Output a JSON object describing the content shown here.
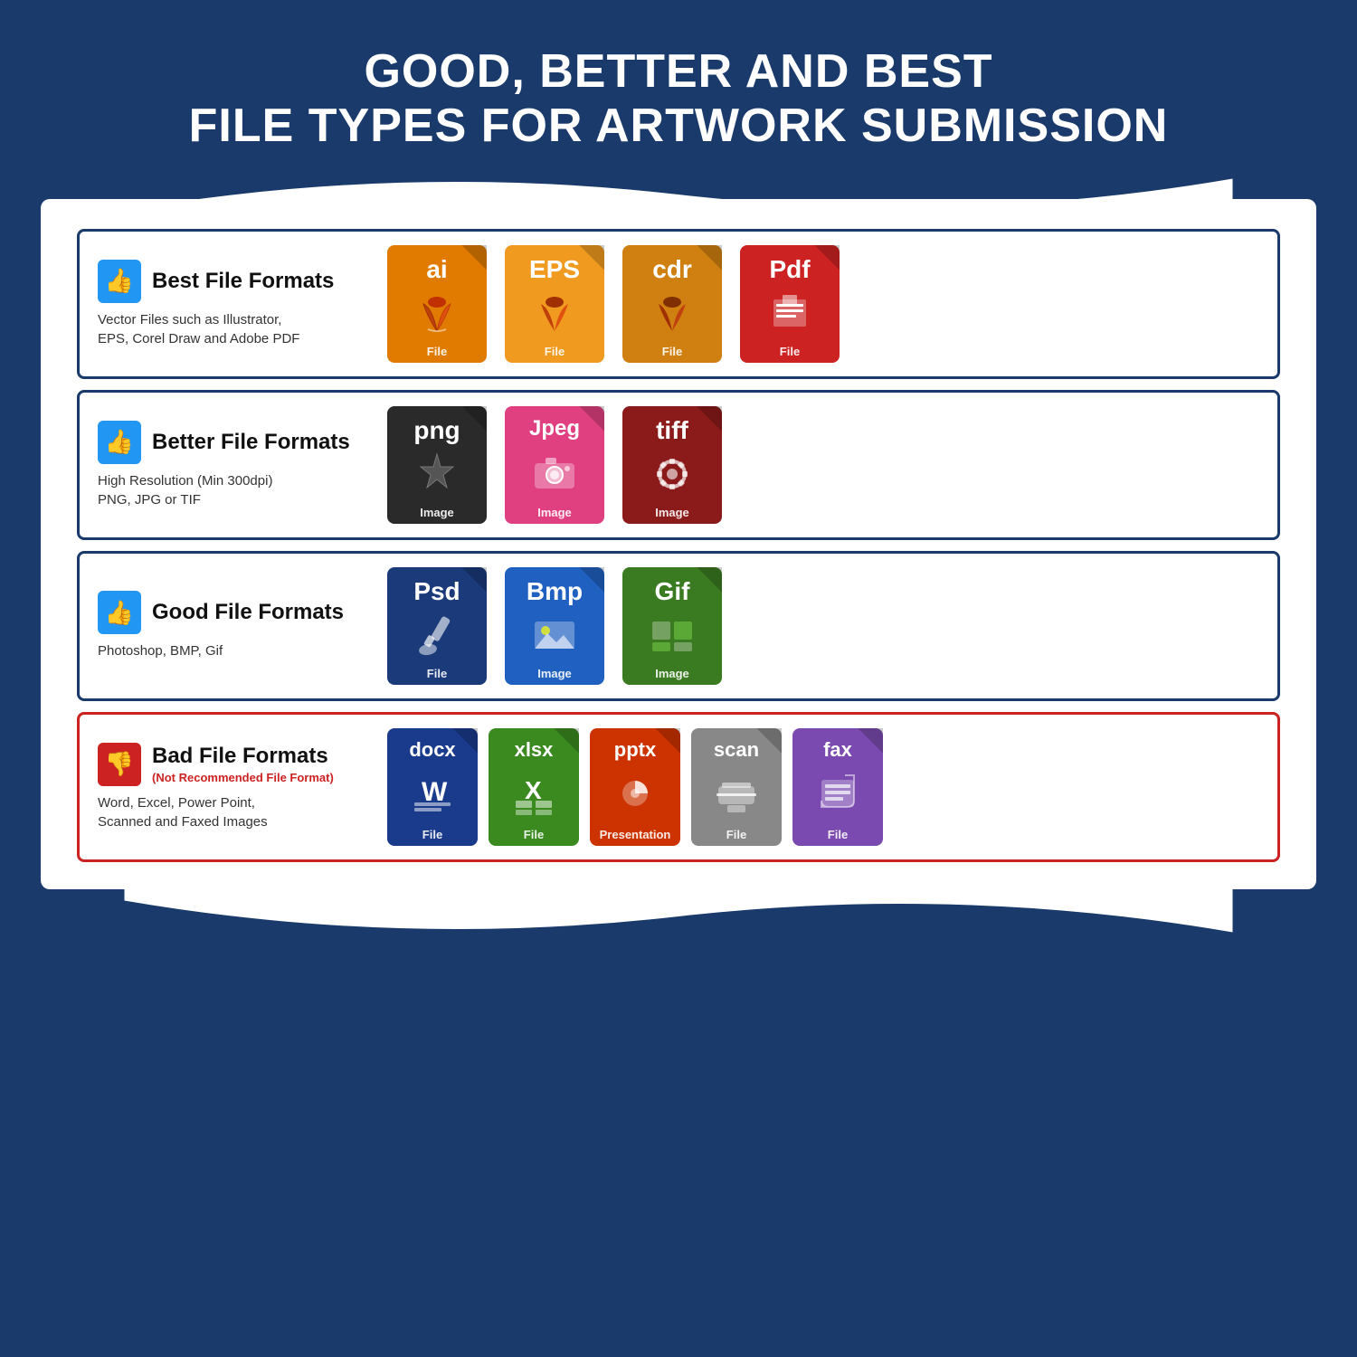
{
  "header": {
    "line1": "GOOD, BETTER AND BEST",
    "line2": "FILE TYPES FOR ARTWORK SUBMISSION"
  },
  "rows": [
    {
      "id": "best",
      "thumb": "👍",
      "thumbBad": false,
      "title": "Best File Formats",
      "subtitle": "",
      "desc": "Vector Files such as Illustrator,\nEPS, Corel Draw and Adobe PDF",
      "borderColor": "#1a3a6b",
      "files": [
        {
          "label": "ai",
          "sublabel": "File",
          "color": "#e07b00",
          "iconType": "pen"
        },
        {
          "label": "EPS",
          "sublabel": "File",
          "color": "#f09a20",
          "iconType": "pen"
        },
        {
          "label": "cdr",
          "sublabel": "File",
          "color": "#d08010",
          "iconType": "pen"
        },
        {
          "label": "Pdf",
          "sublabel": "File",
          "color": "#cc2222",
          "iconType": "doc"
        }
      ]
    },
    {
      "id": "better",
      "thumb": "👍",
      "thumbBad": false,
      "title": "Better File Formats",
      "subtitle": "",
      "desc": "High Resolution (Min 300dpi)\nPNG, JPG or TIF",
      "borderColor": "#1a3a6b",
      "files": [
        {
          "label": "png",
          "sublabel": "Image",
          "color": "#2a2a2a",
          "iconType": "star"
        },
        {
          "label": "Jpeg",
          "sublabel": "Image",
          "color": "#e04080",
          "iconType": "camera"
        },
        {
          "label": "tiff",
          "sublabel": "Image",
          "color": "#8b1a1a",
          "iconType": "gear"
        }
      ]
    },
    {
      "id": "good",
      "thumb": "👍",
      "thumbBad": false,
      "title": "Good File Formats",
      "subtitle": "",
      "desc": "Photoshop, BMP, Gif",
      "borderColor": "#1a3a6b",
      "files": [
        {
          "label": "Psd",
          "sublabel": "File",
          "color": "#1a3a7a",
          "iconType": "brush"
        },
        {
          "label": "Bmp",
          "sublabel": "Image",
          "color": "#2060c0",
          "iconType": "landscape"
        },
        {
          "label": "Gif",
          "sublabel": "Image",
          "color": "#3a7a20",
          "iconType": "grid"
        }
      ]
    },
    {
      "id": "bad",
      "thumb": "👎",
      "thumbBad": true,
      "title": "Bad File Formats",
      "subtitle": "(Not Recommended File Format)",
      "desc": "Word, Excel, Power Point,\nScanned and Faxed Images",
      "borderColor": "#cc2222",
      "files": [
        {
          "label": "docx",
          "sublabel": "File",
          "color": "#1a3a8b",
          "iconType": "word"
        },
        {
          "label": "xlsx",
          "sublabel": "File",
          "color": "#3a8a20",
          "iconType": "excel"
        },
        {
          "label": "pptx",
          "sublabel": "Presentation",
          "color": "#cc3300",
          "iconType": "ppt"
        },
        {
          "label": "scan",
          "sublabel": "File",
          "color": "#888888",
          "iconType": "scan"
        },
        {
          "label": "fax",
          "sublabel": "File",
          "color": "#7a4ab0",
          "iconType": "fax"
        }
      ]
    }
  ]
}
